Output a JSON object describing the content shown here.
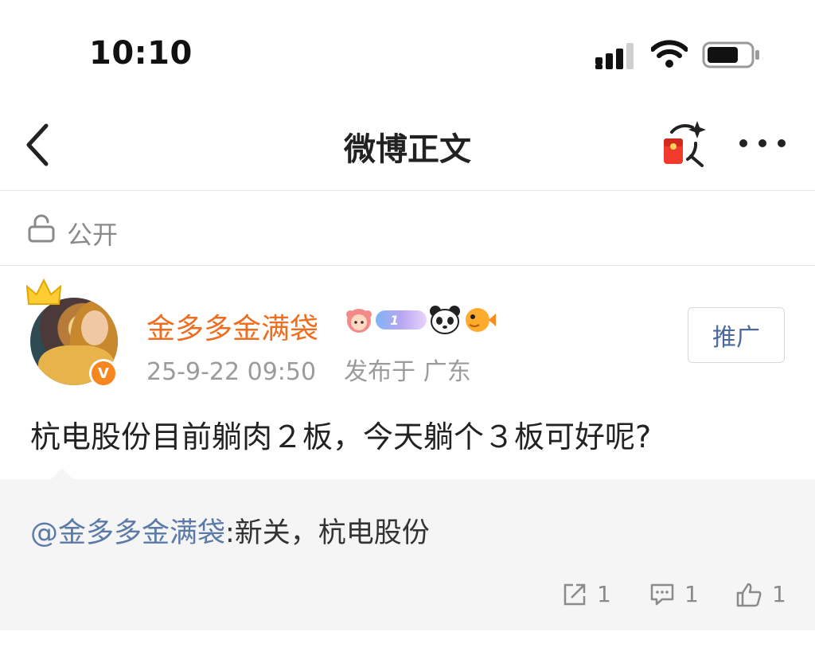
{
  "status_bar": {
    "time": "10:10"
  },
  "nav": {
    "title": "微博正文"
  },
  "visibility": {
    "label": "公开"
  },
  "author": {
    "name": "金多多金满袋",
    "post_time": "25-9-22 09:50",
    "location": "发布于 广东",
    "verified_mark": "V",
    "badge_level": "1"
  },
  "promote_label": "推广",
  "post": {
    "text": "杭电股份目前躺肉２板，今天躺个３板可好呢?"
  },
  "repost": {
    "mention": "@金多多金满袋",
    "text": ":新关，杭电股份"
  },
  "actions": {
    "share_count": "1",
    "comment_count": "1",
    "like_count": "1"
  },
  "colors": {
    "username": "#ee6d1f",
    "mention": "#5b7aa8",
    "verified": "#f7861f",
    "repost_bg": "#f5f5f5"
  }
}
